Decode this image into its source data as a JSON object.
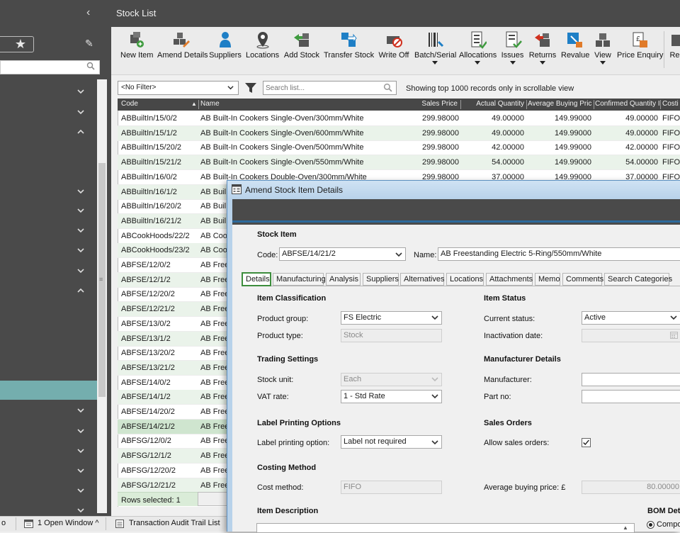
{
  "header": {
    "title": "Stock List"
  },
  "toolbar": {
    "buttons": [
      {
        "label": "New Item",
        "icon": "new-item-icon"
      },
      {
        "label": "Amend Details",
        "icon": "amend-details-icon"
      },
      {
        "label": "Suppliers",
        "icon": "suppliers-icon"
      },
      {
        "label": "Locations",
        "icon": "locations-icon"
      },
      {
        "label": "Add Stock",
        "icon": "add-stock-icon"
      },
      {
        "label": "Transfer Stock",
        "icon": "transfer-stock-icon"
      },
      {
        "label": "Write Off",
        "icon": "write-off-icon"
      },
      {
        "label": "Batch/Serial",
        "icon": "batch-serial-icon"
      },
      {
        "label": "Allocations",
        "icon": "allocations-icon"
      },
      {
        "label": "Issues",
        "icon": "issues-icon"
      },
      {
        "label": "Returns",
        "icon": "returns-icon"
      },
      {
        "label": "Revalue",
        "icon": "revalue-icon"
      },
      {
        "label": "View",
        "icon": "view-icon"
      },
      {
        "label": "Price Enquiry",
        "icon": "price-enquiry-icon"
      },
      {
        "label": "Re",
        "icon": "reports-icon"
      }
    ]
  },
  "filter": {
    "selected": "<No Filter>",
    "search_placeholder": "Search list...",
    "records_note": "Showing top 1000 records only in scrollable view"
  },
  "table": {
    "columns": [
      "Code",
      "Name",
      "Sales Price",
      "Actual Quantity",
      "Average Buying Pric",
      "Confirmed Quantity I",
      "Costi"
    ],
    "rows": [
      {
        "code": "ABBuiltIn/15/0/2",
        "name": "AB Built-In Cookers Single-Oven/300mm/White",
        "sales": "299.98000",
        "actual": "49.00000",
        "avg": "149.99000",
        "confirmed": "49.00000",
        "costing": "FIFO"
      },
      {
        "code": "ABBuiltIn/15/1/2",
        "name": "AB Built-In Cookers Single-Oven/600mm/White",
        "sales": "299.98000",
        "actual": "49.00000",
        "avg": "149.99000",
        "confirmed": "49.00000",
        "costing": "FIFO"
      },
      {
        "code": "ABBuiltIn/15/20/2",
        "name": "AB Built-In Cookers Single-Oven/500mm/White",
        "sales": "299.98000",
        "actual": "42.00000",
        "avg": "149.99000",
        "confirmed": "42.00000",
        "costing": "FIFO"
      },
      {
        "code": "ABBuiltIn/15/21/2",
        "name": "AB Built-In Cookers Single-Oven/550mm/White",
        "sales": "299.98000",
        "actual": "54.00000",
        "avg": "149.99000",
        "confirmed": "54.00000",
        "costing": "FIFO"
      },
      {
        "code": "ABBuiltIn/16/0/2",
        "name": "AB Built-In Cookers Double-Oven/300mm/White",
        "sales": "299.98000",
        "actual": "37.00000",
        "avg": "149.99000",
        "confirmed": "37.00000",
        "costing": "FIFO"
      },
      {
        "code": "ABBuiltIn/16/1/2",
        "name": "AB Buil",
        "sales": "",
        "actual": "",
        "avg": "",
        "confirmed": "",
        "costing": ""
      },
      {
        "code": "ABBuiltIn/16/20/2",
        "name": "AB Buil",
        "sales": "",
        "actual": "",
        "avg": "",
        "confirmed": "",
        "costing": ""
      },
      {
        "code": "ABBuiltIn/16/21/2",
        "name": "AB Buil",
        "sales": "",
        "actual": "",
        "avg": "",
        "confirmed": "",
        "costing": ""
      },
      {
        "code": "ABCookHoods/22/2",
        "name": "AB Coo",
        "sales": "",
        "actual": "",
        "avg": "",
        "confirmed": "",
        "costing": ""
      },
      {
        "code": "ABCookHoods/23/2",
        "name": "AB Coo",
        "sales": "",
        "actual": "",
        "avg": "",
        "confirmed": "",
        "costing": ""
      },
      {
        "code": "ABFSE/12/0/2",
        "name": "AB Free",
        "sales": "",
        "actual": "",
        "avg": "",
        "confirmed": "",
        "costing": ""
      },
      {
        "code": "ABFSE/12/1/2",
        "name": "AB Free",
        "sales": "",
        "actual": "",
        "avg": "",
        "confirmed": "",
        "costing": ""
      },
      {
        "code": "ABFSE/12/20/2",
        "name": "AB Free",
        "sales": "",
        "actual": "",
        "avg": "",
        "confirmed": "",
        "costing": ""
      },
      {
        "code": "ABFSE/12/21/2",
        "name": "AB Free",
        "sales": "",
        "actual": "",
        "avg": "",
        "confirmed": "",
        "costing": ""
      },
      {
        "code": "ABFSE/13/0/2",
        "name": "AB Free",
        "sales": "",
        "actual": "",
        "avg": "",
        "confirmed": "",
        "costing": ""
      },
      {
        "code": "ABFSE/13/1/2",
        "name": "AB Free",
        "sales": "",
        "actual": "",
        "avg": "",
        "confirmed": "",
        "costing": ""
      },
      {
        "code": "ABFSE/13/20/2",
        "name": "AB Free",
        "sales": "",
        "actual": "",
        "avg": "",
        "confirmed": "",
        "costing": ""
      },
      {
        "code": "ABFSE/13/21/2",
        "name": "AB Free",
        "sales": "",
        "actual": "",
        "avg": "",
        "confirmed": "",
        "costing": ""
      },
      {
        "code": "ABFSE/14/0/2",
        "name": "AB Free",
        "sales": "",
        "actual": "",
        "avg": "",
        "confirmed": "",
        "costing": ""
      },
      {
        "code": "ABFSE/14/1/2",
        "name": "AB Free",
        "sales": "",
        "actual": "",
        "avg": "",
        "confirmed": "",
        "costing": ""
      },
      {
        "code": "ABFSE/14/20/2",
        "name": "AB Free",
        "sales": "",
        "actual": "",
        "avg": "",
        "confirmed": "",
        "costing": ""
      },
      {
        "code": "ABFSE/14/21/2",
        "name": "AB Free",
        "sales": "",
        "actual": "",
        "avg": "",
        "confirmed": "",
        "costing": ""
      },
      {
        "code": "ABFSG/12/0/2",
        "name": "AB Free",
        "sales": "",
        "actual": "",
        "avg": "",
        "confirmed": "",
        "costing": ""
      },
      {
        "code": "ABFSG/12/1/2",
        "name": "AB Free",
        "sales": "",
        "actual": "",
        "avg": "",
        "confirmed": "",
        "costing": ""
      },
      {
        "code": "ABFSG/12/20/2",
        "name": "AB Free",
        "sales": "",
        "actual": "",
        "avg": "",
        "confirmed": "",
        "costing": ""
      },
      {
        "code": "ABFSG/12/21/2",
        "name": "AB Free",
        "sales": "",
        "actual": "",
        "avg": "",
        "confirmed": "",
        "costing": ""
      }
    ],
    "rows_selected": "Rows selected: 1"
  },
  "dialog": {
    "title": "Amend Stock Item Details",
    "section_title": "Stock Item",
    "code_label": "Code:",
    "code_value": "ABFSE/14/21/2",
    "name_label": "Name:",
    "name_value": "AB Freestanding Electric 5-Ring/550mm/White",
    "tabs": [
      "Details",
      "Manufacturing",
      "Analysis",
      "Suppliers",
      "Alternatives",
      "Locations",
      "Attachments",
      "Memo",
      "Comments",
      "Search Categories"
    ],
    "classification": {
      "heading": "Item Classification",
      "group_label": "Product group:",
      "group_value": "FS Electric",
      "type_label": "Product type:",
      "type_value": "Stock"
    },
    "trading": {
      "heading": "Trading Settings",
      "unit_label": "Stock unit:",
      "unit_value": "Each",
      "vat_label": "VAT rate:",
      "vat_value": "1 - Std Rate"
    },
    "label_printing": {
      "heading": "Label Printing Options",
      "option_label": "Label printing option:",
      "option_value": "Label not required"
    },
    "costing": {
      "heading": "Costing Method",
      "method_label": "Cost method:",
      "method_value": "FIFO"
    },
    "description": {
      "heading": "Item Description"
    },
    "status": {
      "heading": "Item Status",
      "current_label": "Current status:",
      "current_value": "Active",
      "inactivation_label": "Inactivation date:"
    },
    "manufacturer": {
      "heading": "Manufacturer Details",
      "manufacturer_label": "Manufacturer:",
      "partno_label": "Part no:"
    },
    "sales_orders": {
      "heading": "Sales Orders",
      "allow_label": "Allow sales orders:",
      "allow_checked": true
    },
    "avg_buying": {
      "label": "Average buying price: £",
      "value": "80.00000"
    },
    "bom": {
      "heading": "BOM Deta",
      "option": "Compo"
    }
  },
  "statusbar": {
    "open_windows": "1 Open Window ^",
    "audit": "Transaction Audit Trail List"
  },
  "colors": {
    "sidebar_bg": "#4a4a4a",
    "selected_nav": "#74aeae",
    "row_alt": "#eaf3ea",
    "active_tab": "#3d8d3d"
  }
}
